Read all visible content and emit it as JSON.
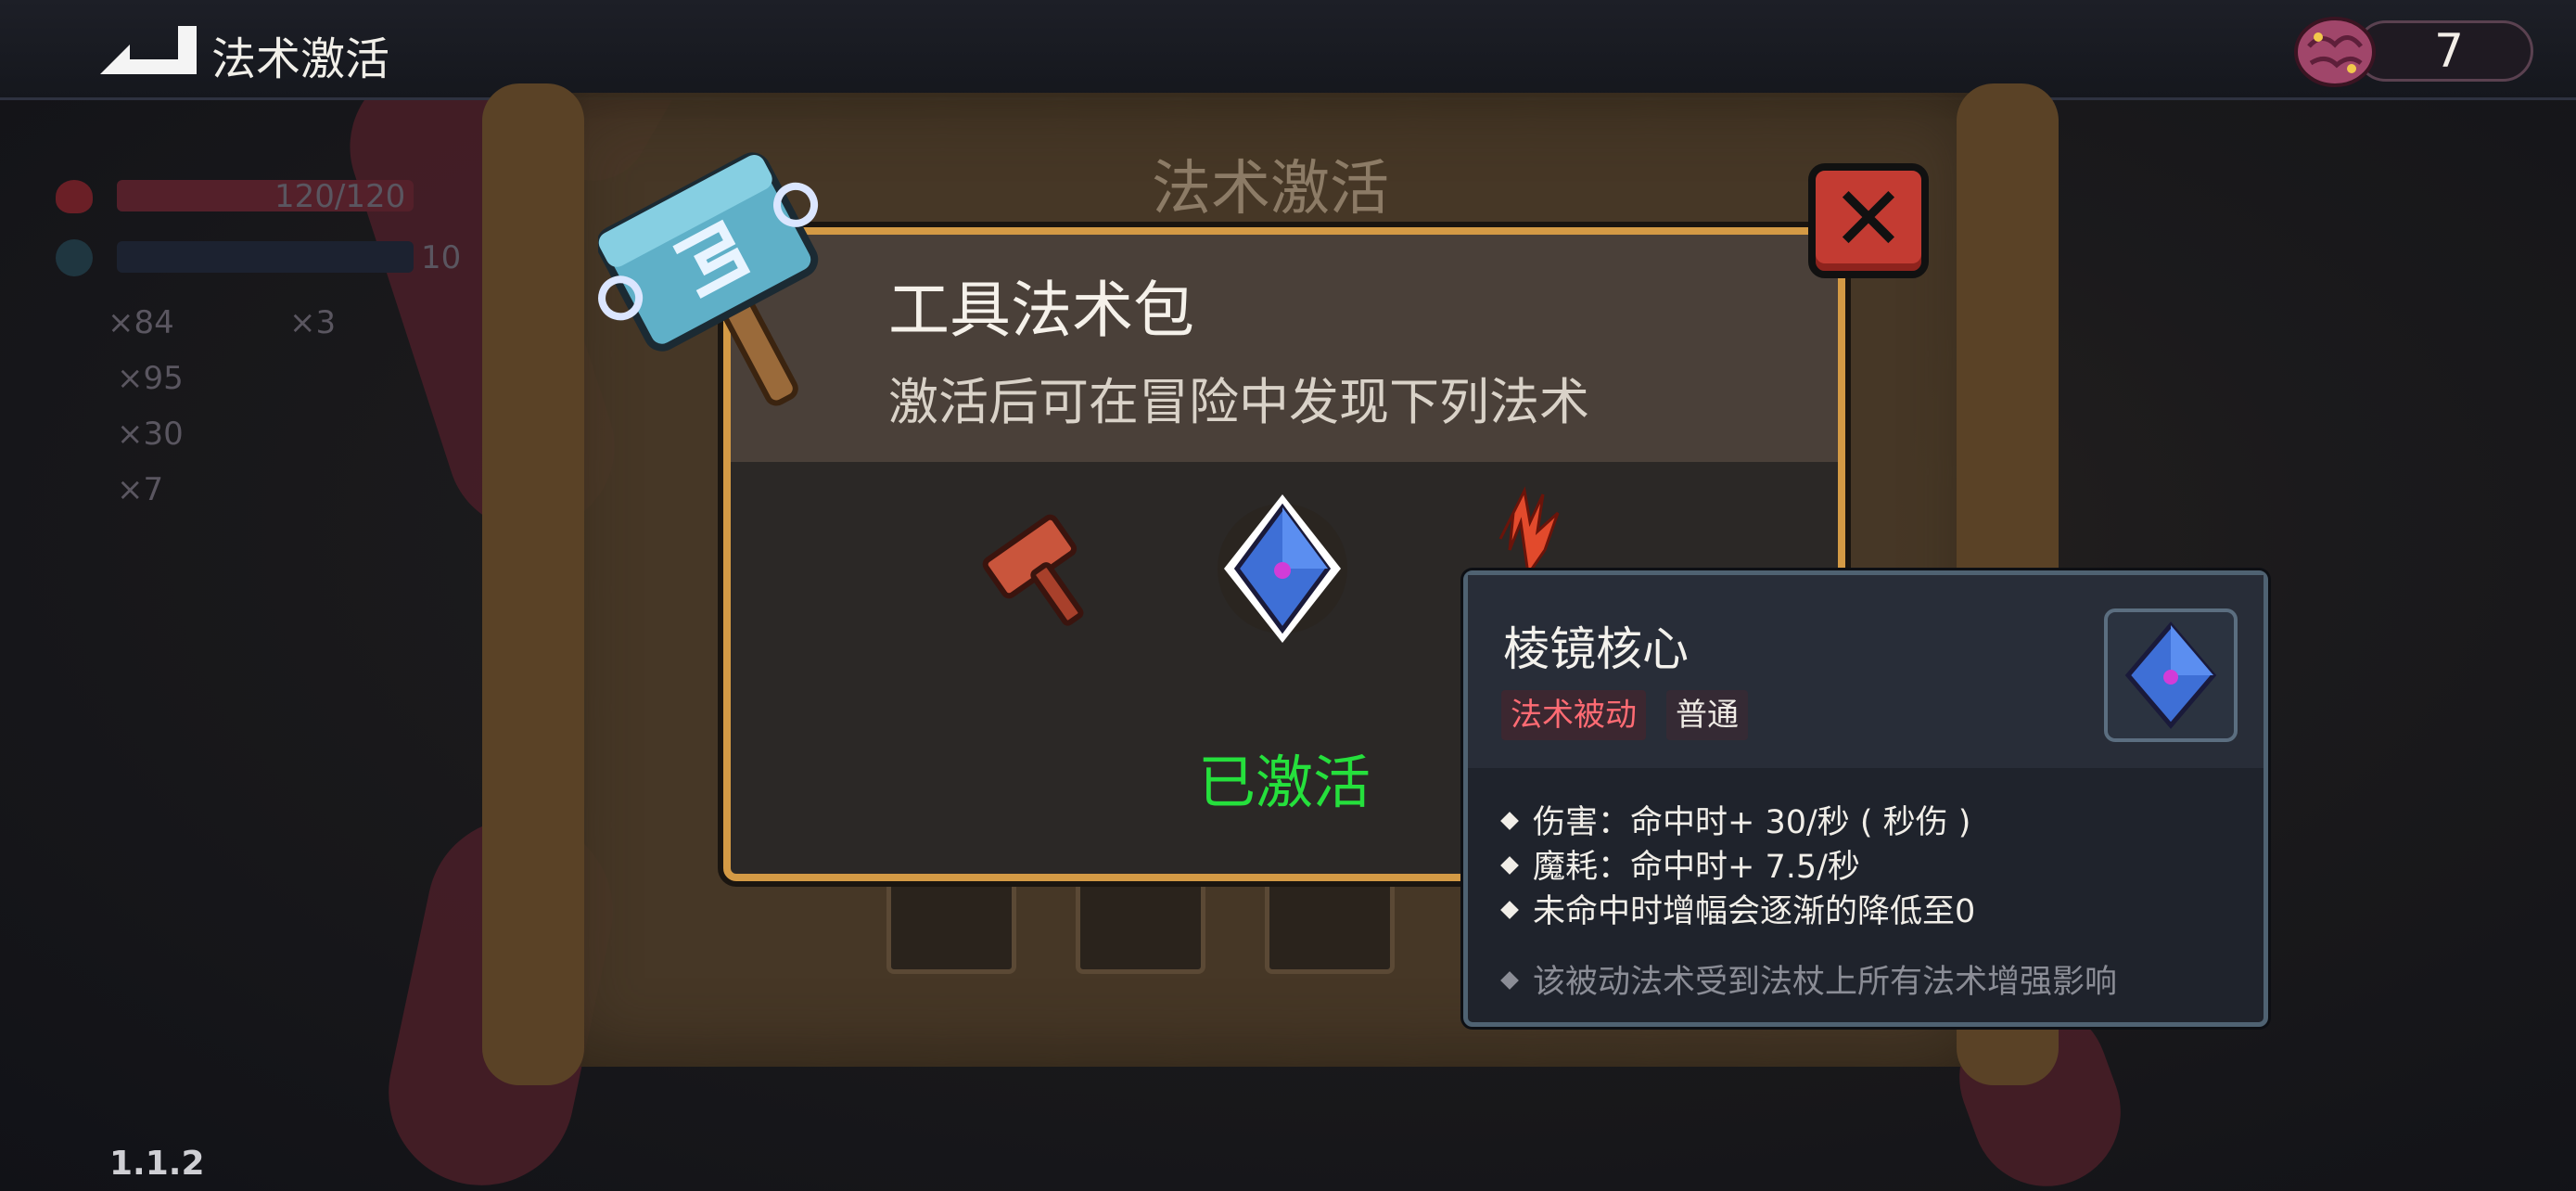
{
  "topbar": {
    "title": "法术激活",
    "currency_value": "7"
  },
  "hud": {
    "hp": "120/120",
    "mp": "10",
    "counts": [
      "×84",
      "×3",
      "×95",
      "×30",
      "×7"
    ]
  },
  "panel": {
    "title": "法术激活"
  },
  "dialog": {
    "pack_name": "工具法术包",
    "pack_desc": "激活后可在冒险中发现下列法术",
    "status": "已激活"
  },
  "tooltip": {
    "name": "棱镜核心",
    "tags": [
      "法术被动",
      "普通"
    ],
    "stats": [
      "伤害：命中时+ 30/秒 ( 秒伤 )",
      "魔耗：命中时+ 7.5/秒",
      "未命中时增幅会逐渐的降低至0"
    ],
    "note": "该被动法术受到法杖上所有法术增强影响"
  },
  "version": "1.1.2",
  "colors": {
    "frame_gold": "#d49a45",
    "activated_green": "#25e03c",
    "tag_red": "#ff6b73",
    "close_red": "#c33b32"
  },
  "icons": [
    "back-arrow-icon",
    "brain-currency-icon",
    "hammer-pack-icon",
    "close-x-icon",
    "red-hammer-spell-icon",
    "prism-core-spell-icon",
    "red-burst-spell-icon"
  ]
}
